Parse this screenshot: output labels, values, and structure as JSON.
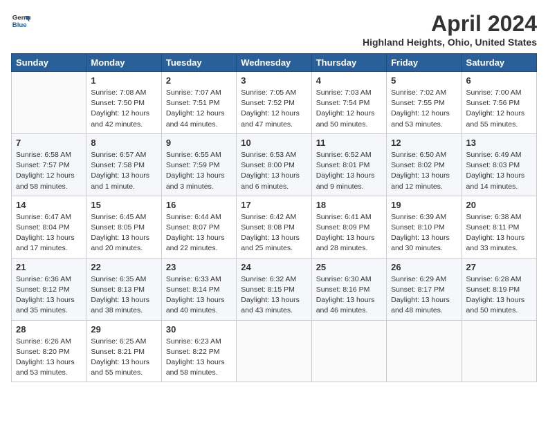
{
  "header": {
    "logo_general": "General",
    "logo_blue": "Blue",
    "month_title": "April 2024",
    "location": "Highland Heights, Ohio, United States"
  },
  "weekdays": [
    "Sunday",
    "Monday",
    "Tuesday",
    "Wednesday",
    "Thursday",
    "Friday",
    "Saturday"
  ],
  "weeks": [
    [
      {
        "day": "",
        "info": ""
      },
      {
        "day": "1",
        "info": "Sunrise: 7:08 AM\nSunset: 7:50 PM\nDaylight: 12 hours\nand 42 minutes."
      },
      {
        "day": "2",
        "info": "Sunrise: 7:07 AM\nSunset: 7:51 PM\nDaylight: 12 hours\nand 44 minutes."
      },
      {
        "day": "3",
        "info": "Sunrise: 7:05 AM\nSunset: 7:52 PM\nDaylight: 12 hours\nand 47 minutes."
      },
      {
        "day": "4",
        "info": "Sunrise: 7:03 AM\nSunset: 7:54 PM\nDaylight: 12 hours\nand 50 minutes."
      },
      {
        "day": "5",
        "info": "Sunrise: 7:02 AM\nSunset: 7:55 PM\nDaylight: 12 hours\nand 53 minutes."
      },
      {
        "day": "6",
        "info": "Sunrise: 7:00 AM\nSunset: 7:56 PM\nDaylight: 12 hours\nand 55 minutes."
      }
    ],
    [
      {
        "day": "7",
        "info": "Sunrise: 6:58 AM\nSunset: 7:57 PM\nDaylight: 12 hours\nand 58 minutes."
      },
      {
        "day": "8",
        "info": "Sunrise: 6:57 AM\nSunset: 7:58 PM\nDaylight: 13 hours\nand 1 minute."
      },
      {
        "day": "9",
        "info": "Sunrise: 6:55 AM\nSunset: 7:59 PM\nDaylight: 13 hours\nand 3 minutes."
      },
      {
        "day": "10",
        "info": "Sunrise: 6:53 AM\nSunset: 8:00 PM\nDaylight: 13 hours\nand 6 minutes."
      },
      {
        "day": "11",
        "info": "Sunrise: 6:52 AM\nSunset: 8:01 PM\nDaylight: 13 hours\nand 9 minutes."
      },
      {
        "day": "12",
        "info": "Sunrise: 6:50 AM\nSunset: 8:02 PM\nDaylight: 13 hours\nand 12 minutes."
      },
      {
        "day": "13",
        "info": "Sunrise: 6:49 AM\nSunset: 8:03 PM\nDaylight: 13 hours\nand 14 minutes."
      }
    ],
    [
      {
        "day": "14",
        "info": "Sunrise: 6:47 AM\nSunset: 8:04 PM\nDaylight: 13 hours\nand 17 minutes."
      },
      {
        "day": "15",
        "info": "Sunrise: 6:45 AM\nSunset: 8:05 PM\nDaylight: 13 hours\nand 20 minutes."
      },
      {
        "day": "16",
        "info": "Sunrise: 6:44 AM\nSunset: 8:07 PM\nDaylight: 13 hours\nand 22 minutes."
      },
      {
        "day": "17",
        "info": "Sunrise: 6:42 AM\nSunset: 8:08 PM\nDaylight: 13 hours\nand 25 minutes."
      },
      {
        "day": "18",
        "info": "Sunrise: 6:41 AM\nSunset: 8:09 PM\nDaylight: 13 hours\nand 28 minutes."
      },
      {
        "day": "19",
        "info": "Sunrise: 6:39 AM\nSunset: 8:10 PM\nDaylight: 13 hours\nand 30 minutes."
      },
      {
        "day": "20",
        "info": "Sunrise: 6:38 AM\nSunset: 8:11 PM\nDaylight: 13 hours\nand 33 minutes."
      }
    ],
    [
      {
        "day": "21",
        "info": "Sunrise: 6:36 AM\nSunset: 8:12 PM\nDaylight: 13 hours\nand 35 minutes."
      },
      {
        "day": "22",
        "info": "Sunrise: 6:35 AM\nSunset: 8:13 PM\nDaylight: 13 hours\nand 38 minutes."
      },
      {
        "day": "23",
        "info": "Sunrise: 6:33 AM\nSunset: 8:14 PM\nDaylight: 13 hours\nand 40 minutes."
      },
      {
        "day": "24",
        "info": "Sunrise: 6:32 AM\nSunset: 8:15 PM\nDaylight: 13 hours\nand 43 minutes."
      },
      {
        "day": "25",
        "info": "Sunrise: 6:30 AM\nSunset: 8:16 PM\nDaylight: 13 hours\nand 46 minutes."
      },
      {
        "day": "26",
        "info": "Sunrise: 6:29 AM\nSunset: 8:17 PM\nDaylight: 13 hours\nand 48 minutes."
      },
      {
        "day": "27",
        "info": "Sunrise: 6:28 AM\nSunset: 8:19 PM\nDaylight: 13 hours\nand 50 minutes."
      }
    ],
    [
      {
        "day": "28",
        "info": "Sunrise: 6:26 AM\nSunset: 8:20 PM\nDaylight: 13 hours\nand 53 minutes."
      },
      {
        "day": "29",
        "info": "Sunrise: 6:25 AM\nSunset: 8:21 PM\nDaylight: 13 hours\nand 55 minutes."
      },
      {
        "day": "30",
        "info": "Sunrise: 6:23 AM\nSunset: 8:22 PM\nDaylight: 13 hours\nand 58 minutes."
      },
      {
        "day": "",
        "info": ""
      },
      {
        "day": "",
        "info": ""
      },
      {
        "day": "",
        "info": ""
      },
      {
        "day": "",
        "info": ""
      }
    ]
  ]
}
